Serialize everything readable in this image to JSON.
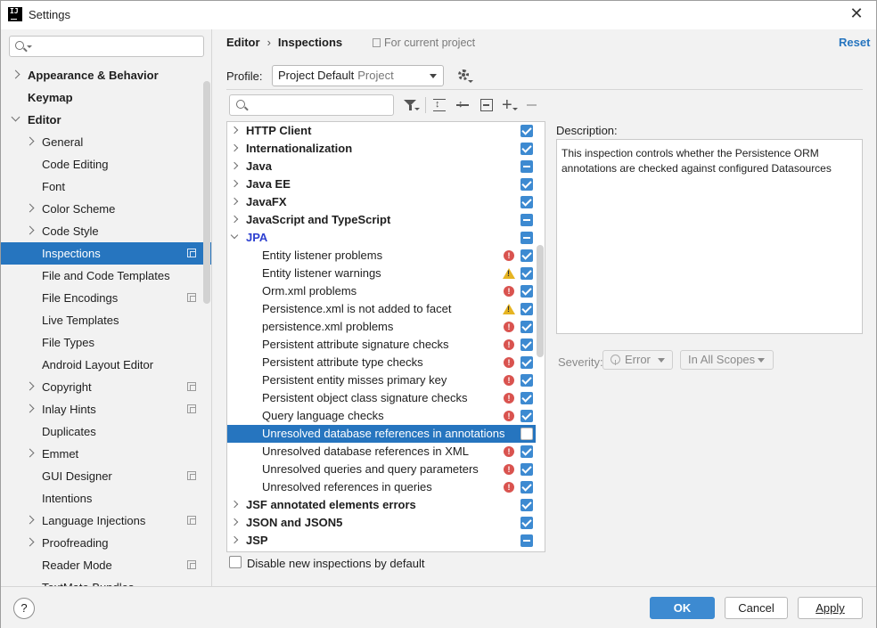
{
  "window": {
    "title": "Settings",
    "close_icon": "close-icon",
    "app_icon_text": "IJ"
  },
  "sidebar": {
    "search_placeholder": "",
    "items": [
      {
        "label": "Appearance & Behavior",
        "level": 0,
        "chevron": "right",
        "badge": false,
        "selected": false
      },
      {
        "label": "Keymap",
        "level": 0,
        "chevron": "none",
        "badge": false,
        "selected": false
      },
      {
        "label": "Editor",
        "level": 0,
        "chevron": "open",
        "badge": false,
        "selected": false
      },
      {
        "label": "General",
        "level": 1,
        "chevron": "right",
        "badge": false,
        "selected": false
      },
      {
        "label": "Code Editing",
        "level": 1,
        "chevron": "none",
        "badge": false,
        "selected": false
      },
      {
        "label": "Font",
        "level": 1,
        "chevron": "none",
        "badge": false,
        "selected": false
      },
      {
        "label": "Color Scheme",
        "level": 1,
        "chevron": "right",
        "badge": false,
        "selected": false
      },
      {
        "label": "Code Style",
        "level": 1,
        "chevron": "right",
        "badge": false,
        "selected": false
      },
      {
        "label": "Inspections",
        "level": 1,
        "chevron": "none",
        "badge": true,
        "selected": true
      },
      {
        "label": "File and Code Templates",
        "level": 1,
        "chevron": "none",
        "badge": false,
        "selected": false
      },
      {
        "label": "File Encodings",
        "level": 1,
        "chevron": "none",
        "badge": true,
        "selected": false
      },
      {
        "label": "Live Templates",
        "level": 1,
        "chevron": "none",
        "badge": false,
        "selected": false
      },
      {
        "label": "File Types",
        "level": 1,
        "chevron": "none",
        "badge": false,
        "selected": false
      },
      {
        "label": "Android Layout Editor",
        "level": 1,
        "chevron": "none",
        "badge": false,
        "selected": false
      },
      {
        "label": "Copyright",
        "level": 1,
        "chevron": "right",
        "badge": true,
        "selected": false
      },
      {
        "label": "Inlay Hints",
        "level": 1,
        "chevron": "right",
        "badge": true,
        "selected": false
      },
      {
        "label": "Duplicates",
        "level": 1,
        "chevron": "none",
        "badge": false,
        "selected": false
      },
      {
        "label": "Emmet",
        "level": 1,
        "chevron": "right",
        "badge": false,
        "selected": false
      },
      {
        "label": "GUI Designer",
        "level": 1,
        "chevron": "none",
        "badge": true,
        "selected": false
      },
      {
        "label": "Intentions",
        "level": 1,
        "chevron": "none",
        "badge": false,
        "selected": false
      },
      {
        "label": "Language Injections",
        "level": 1,
        "chevron": "right",
        "badge": true,
        "selected": false
      },
      {
        "label": "Proofreading",
        "level": 1,
        "chevron": "right",
        "badge": false,
        "selected": false
      },
      {
        "label": "Reader Mode",
        "level": 1,
        "chevron": "none",
        "badge": true,
        "selected": false
      },
      {
        "label": "TextMate Bundles",
        "level": 1,
        "chevron": "none",
        "badge": false,
        "selected": false
      }
    ]
  },
  "header": {
    "breadcrumb": [
      "Editor",
      "Inspections"
    ],
    "breadcrumb_separator": "›",
    "scope_note": "For current project",
    "reset_label": "Reset"
  },
  "profile": {
    "label": "Profile:",
    "value": "Project Default",
    "sub": "Project"
  },
  "filter": {
    "placeholder": ""
  },
  "tree": {
    "rows": [
      {
        "label": "HTTP Client",
        "group": true,
        "chevron": "right",
        "state": "check",
        "severity": "",
        "selected": false
      },
      {
        "label": "Internationalization",
        "group": true,
        "chevron": "right",
        "state": "check",
        "severity": "",
        "selected": false
      },
      {
        "label": "Java",
        "group": true,
        "chevron": "right",
        "state": "partial",
        "severity": "",
        "selected": false
      },
      {
        "label": "Java EE",
        "group": true,
        "chevron": "right",
        "state": "check",
        "severity": "",
        "selected": false
      },
      {
        "label": "JavaFX",
        "group": true,
        "chevron": "right",
        "state": "check",
        "severity": "",
        "selected": false
      },
      {
        "label": "JavaScript and TypeScript",
        "group": true,
        "chevron": "right",
        "state": "partial",
        "severity": "",
        "selected": false
      },
      {
        "label": "JPA",
        "group": true,
        "chevron": "open",
        "state": "partial",
        "severity": "",
        "selected": false,
        "modified": true
      },
      {
        "label": "Entity listener problems",
        "group": false,
        "state": "check",
        "severity": "error",
        "selected": false
      },
      {
        "label": "Entity listener warnings",
        "group": false,
        "state": "check",
        "severity": "warning",
        "selected": false
      },
      {
        "label": "Orm.xml problems",
        "group": false,
        "state": "check",
        "severity": "error",
        "selected": false
      },
      {
        "label": "Persistence.xml is not added to facet",
        "group": false,
        "state": "check",
        "severity": "warning",
        "selected": false
      },
      {
        "label": "persistence.xml problems",
        "group": false,
        "state": "check",
        "severity": "error",
        "selected": false
      },
      {
        "label": "Persistent attribute signature checks",
        "group": false,
        "state": "check",
        "severity": "error",
        "selected": false
      },
      {
        "label": "Persistent attribute type checks",
        "group": false,
        "state": "check",
        "severity": "error",
        "selected": false
      },
      {
        "label": "Persistent entity misses primary key",
        "group": false,
        "state": "check",
        "severity": "error",
        "selected": false
      },
      {
        "label": "Persistent object class signature checks",
        "group": false,
        "state": "check",
        "severity": "error",
        "selected": false
      },
      {
        "label": "Query language checks",
        "group": false,
        "state": "check",
        "severity": "error",
        "selected": false
      },
      {
        "label": "Unresolved database references in annotations",
        "group": false,
        "state": "empty",
        "severity": "",
        "selected": true
      },
      {
        "label": "Unresolved database references in XML",
        "group": false,
        "state": "check",
        "severity": "error",
        "selected": false
      },
      {
        "label": "Unresolved queries and query parameters",
        "group": false,
        "state": "check",
        "severity": "error",
        "selected": false
      },
      {
        "label": "Unresolved references in queries",
        "group": false,
        "state": "check",
        "severity": "error",
        "selected": false
      },
      {
        "label": "JSF annotated elements errors",
        "group": true,
        "chevron": "right",
        "state": "check",
        "severity": "",
        "selected": false
      },
      {
        "label": "JSON and JSON5",
        "group": true,
        "chevron": "right",
        "state": "check",
        "severity": "",
        "selected": false
      },
      {
        "label": "JSP",
        "group": true,
        "chevron": "right",
        "state": "partial",
        "severity": "",
        "selected": false
      }
    ]
  },
  "disable_new": {
    "label": "Disable new inspections by default",
    "checked": false
  },
  "description": {
    "label": "Description:",
    "text": "This inspection controls whether the Persistence ORM annotations are checked against configured Datasources"
  },
  "severity": {
    "label": "Severity:",
    "value": "Error",
    "scope": "In All Scopes"
  },
  "buttons": {
    "help": "?",
    "ok": "OK",
    "cancel": "Cancel",
    "apply": "Apply"
  },
  "colors": {
    "accent": "#2675bf",
    "checkbox": "#3d8ad1",
    "error": "#d9534f",
    "warning": "#e6b422",
    "modified_group": "#2c3fd0"
  }
}
